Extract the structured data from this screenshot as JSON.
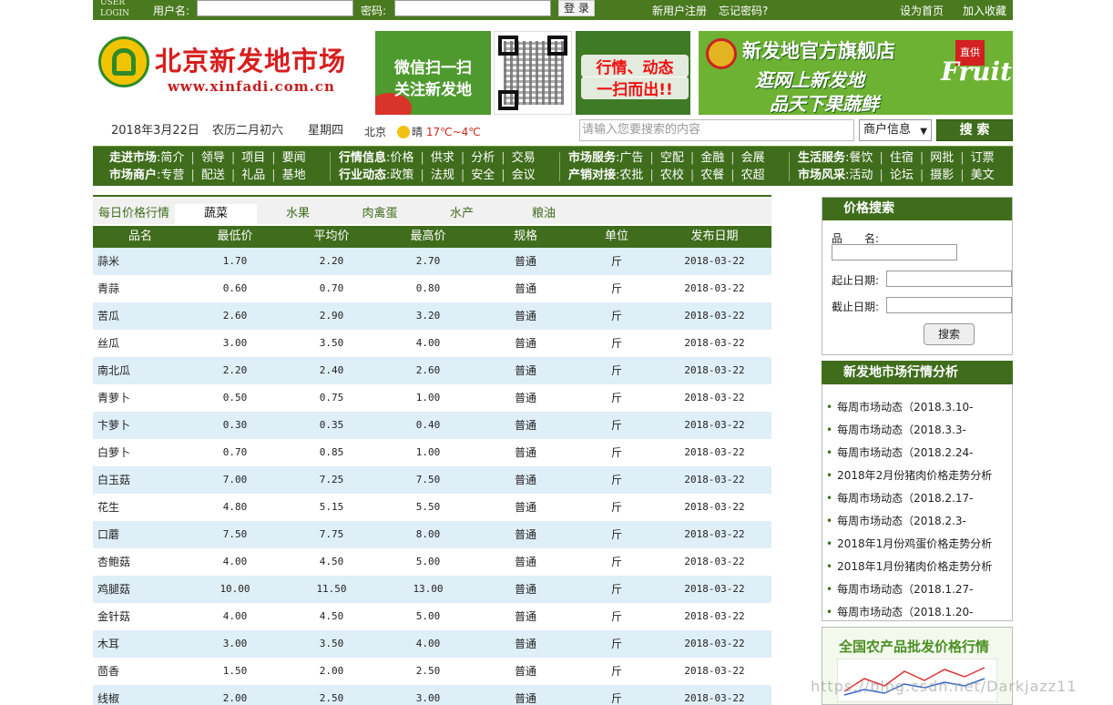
{
  "topbar": {
    "user_login": "USER LOGIN",
    "username_label": "用户名:",
    "password_label": "密码:",
    "login_button": "登 录",
    "register_link": "新用户注册",
    "forgot_link": "忘记密码?",
    "homepage_link": "设为首页",
    "favorite_link": "加入收藏"
  },
  "header": {
    "logo_name": "北京新发地市场",
    "logo_url": "www.xinfadi.com.cn",
    "wechat_line1": "微信扫一扫",
    "wechat_line2": "关注新发地",
    "market_line1": "行情、动态",
    "market_line2": "一扫而出!!",
    "flagship_title": "新发地官方旗舰店",
    "flagship_line2": "逛网上新发地",
    "flagship_line3": "品天下果蔬鲜",
    "flagship_tag": "直供",
    "flagship_fruit": "Fruit"
  },
  "daterow": {
    "date": "2018年3月22日",
    "lunar": "农历二月初六",
    "weekday": "星期四",
    "city": "北京",
    "weather": "晴",
    "temp": "17℃~4℃"
  },
  "search": {
    "placeholder": "请输入您要搜索的内容",
    "category": "商户信息",
    "button": "搜 索"
  },
  "nav": {
    "groups": [
      {
        "t1": "走进市场",
        "i1": [
          "简介",
          "领导",
          "项目",
          "要闻"
        ],
        "t2": "市场商户",
        "i2": [
          "专营",
          "配送",
          "礼品",
          "基地"
        ]
      },
      {
        "t1": "行情信息",
        "i1": [
          "价格",
          "供求",
          "分析",
          "交易"
        ],
        "t2": "行业动态",
        "i2": [
          "政策",
          "法规",
          "安全",
          "会议"
        ]
      },
      {
        "t1": "市场服务",
        "i1": [
          "广告",
          "空配",
          "金融",
          "会展"
        ],
        "t2": "产销对接",
        "i2": [
          "农批",
          "农校",
          "农餐",
          "农超"
        ]
      },
      {
        "t1": "生活服务",
        "i1": [
          "餐饮",
          "住宿",
          "网批",
          "订票"
        ],
        "t2": "市场风采",
        "i2": [
          "活动",
          "论坛",
          "摄影",
          "美文"
        ]
      }
    ]
  },
  "tabs": {
    "title": "每日价格行情",
    "items": [
      "蔬菜",
      "水果",
      "肉禽蛋",
      "水产",
      "粮油"
    ]
  },
  "table": {
    "headers": [
      "品名",
      "最低价",
      "平均价",
      "最高价",
      "规格",
      "单位",
      "发布日期"
    ],
    "rows": [
      [
        "蒜米",
        "1.70",
        "2.20",
        "2.70",
        "普通",
        "斤",
        "2018-03-22"
      ],
      [
        "青蒜",
        "0.60",
        "0.70",
        "0.80",
        "普通",
        "斤",
        "2018-03-22"
      ],
      [
        "苦瓜",
        "2.60",
        "2.90",
        "3.20",
        "普通",
        "斤",
        "2018-03-22"
      ],
      [
        "丝瓜",
        "3.00",
        "3.50",
        "4.00",
        "普通",
        "斤",
        "2018-03-22"
      ],
      [
        "南北瓜",
        "2.20",
        "2.40",
        "2.60",
        "普通",
        "斤",
        "2018-03-22"
      ],
      [
        "青萝卜",
        "0.50",
        "0.75",
        "1.00",
        "普通",
        "斤",
        "2018-03-22"
      ],
      [
        "卞萝卜",
        "0.30",
        "0.35",
        "0.40",
        "普通",
        "斤",
        "2018-03-22"
      ],
      [
        "白萝卜",
        "0.70",
        "0.85",
        "1.00",
        "普通",
        "斤",
        "2018-03-22"
      ],
      [
        "白玉菇",
        "7.00",
        "7.25",
        "7.50",
        "普通",
        "斤",
        "2018-03-22"
      ],
      [
        "花生",
        "4.80",
        "5.15",
        "5.50",
        "普通",
        "斤",
        "2018-03-22"
      ],
      [
        "口蘑",
        "7.50",
        "7.75",
        "8.00",
        "普通",
        "斤",
        "2018-03-22"
      ],
      [
        "杏鲍菇",
        "4.00",
        "4.50",
        "5.00",
        "普通",
        "斤",
        "2018-03-22"
      ],
      [
        "鸡腿菇",
        "10.00",
        "11.50",
        "13.00",
        "普通",
        "斤",
        "2018-03-22"
      ],
      [
        "金针菇",
        "4.00",
        "4.50",
        "5.00",
        "普通",
        "斤",
        "2018-03-22"
      ],
      [
        "木耳",
        "3.00",
        "3.50",
        "4.00",
        "普通",
        "斤",
        "2018-03-22"
      ],
      [
        "茴香",
        "1.50",
        "2.00",
        "2.50",
        "普通",
        "斤",
        "2018-03-22"
      ],
      [
        "线椒",
        "2.00",
        "2.50",
        "3.00",
        "普通",
        "斤",
        "2018-03-22"
      ]
    ]
  },
  "price_search": {
    "title": "价格搜索",
    "name_label": "品　　名:",
    "start_label": "起止日期:",
    "end_label": "截止日期:",
    "button": "搜索"
  },
  "analysis": {
    "title": "新发地市场行情分析",
    "items": [
      "每周市场动态（2018.3.10-",
      "每周市场动态（2018.3.3-",
      "每周市场动态（2018.2.24-",
      "2018年2月份猪肉价格走势分析",
      "每周市场动态（2018.2.17-",
      "每周市场动态（2018.2.3-",
      "2018年1月份鸡蛋价格走势分析",
      "2018年1月份猪肉价格走势分析",
      "每周市场动态（2018.1.27-",
      "每周市场动态（2018.1.20-"
    ]
  },
  "national": {
    "title": "全国农产品批发价格行情"
  },
  "watermark": "https://blog.csdn.net/Darkjazz11",
  "colors": {
    "brand_green": "#3f6d1c",
    "row_alt": "#dfeff8",
    "logo_red": "#d81e1e"
  }
}
